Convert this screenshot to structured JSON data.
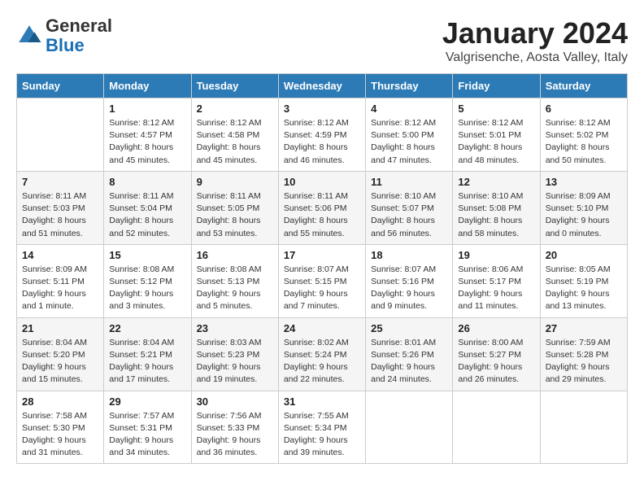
{
  "logo": {
    "general": "General",
    "blue": "Blue"
  },
  "title": "January 2024",
  "subtitle": "Valgrisenche, Aosta Valley, Italy",
  "days_of_week": [
    "Sunday",
    "Monday",
    "Tuesday",
    "Wednesday",
    "Thursday",
    "Friday",
    "Saturday"
  ],
  "weeks": [
    [
      {
        "day": "",
        "info": ""
      },
      {
        "day": "1",
        "info": "Sunrise: 8:12 AM\nSunset: 4:57 PM\nDaylight: 8 hours\nand 45 minutes."
      },
      {
        "day": "2",
        "info": "Sunrise: 8:12 AM\nSunset: 4:58 PM\nDaylight: 8 hours\nand 45 minutes."
      },
      {
        "day": "3",
        "info": "Sunrise: 8:12 AM\nSunset: 4:59 PM\nDaylight: 8 hours\nand 46 minutes."
      },
      {
        "day": "4",
        "info": "Sunrise: 8:12 AM\nSunset: 5:00 PM\nDaylight: 8 hours\nand 47 minutes."
      },
      {
        "day": "5",
        "info": "Sunrise: 8:12 AM\nSunset: 5:01 PM\nDaylight: 8 hours\nand 48 minutes."
      },
      {
        "day": "6",
        "info": "Sunrise: 8:12 AM\nSunset: 5:02 PM\nDaylight: 8 hours\nand 50 minutes."
      }
    ],
    [
      {
        "day": "7",
        "info": "Sunrise: 8:11 AM\nSunset: 5:03 PM\nDaylight: 8 hours\nand 51 minutes."
      },
      {
        "day": "8",
        "info": "Sunrise: 8:11 AM\nSunset: 5:04 PM\nDaylight: 8 hours\nand 52 minutes."
      },
      {
        "day": "9",
        "info": "Sunrise: 8:11 AM\nSunset: 5:05 PM\nDaylight: 8 hours\nand 53 minutes."
      },
      {
        "day": "10",
        "info": "Sunrise: 8:11 AM\nSunset: 5:06 PM\nDaylight: 8 hours\nand 55 minutes."
      },
      {
        "day": "11",
        "info": "Sunrise: 8:10 AM\nSunset: 5:07 PM\nDaylight: 8 hours\nand 56 minutes."
      },
      {
        "day": "12",
        "info": "Sunrise: 8:10 AM\nSunset: 5:08 PM\nDaylight: 8 hours\nand 58 minutes."
      },
      {
        "day": "13",
        "info": "Sunrise: 8:09 AM\nSunset: 5:10 PM\nDaylight: 9 hours\nand 0 minutes."
      }
    ],
    [
      {
        "day": "14",
        "info": "Sunrise: 8:09 AM\nSunset: 5:11 PM\nDaylight: 9 hours\nand 1 minute."
      },
      {
        "day": "15",
        "info": "Sunrise: 8:08 AM\nSunset: 5:12 PM\nDaylight: 9 hours\nand 3 minutes."
      },
      {
        "day": "16",
        "info": "Sunrise: 8:08 AM\nSunset: 5:13 PM\nDaylight: 9 hours\nand 5 minutes."
      },
      {
        "day": "17",
        "info": "Sunrise: 8:07 AM\nSunset: 5:15 PM\nDaylight: 9 hours\nand 7 minutes."
      },
      {
        "day": "18",
        "info": "Sunrise: 8:07 AM\nSunset: 5:16 PM\nDaylight: 9 hours\nand 9 minutes."
      },
      {
        "day": "19",
        "info": "Sunrise: 8:06 AM\nSunset: 5:17 PM\nDaylight: 9 hours\nand 11 minutes."
      },
      {
        "day": "20",
        "info": "Sunrise: 8:05 AM\nSunset: 5:19 PM\nDaylight: 9 hours\nand 13 minutes."
      }
    ],
    [
      {
        "day": "21",
        "info": "Sunrise: 8:04 AM\nSunset: 5:20 PM\nDaylight: 9 hours\nand 15 minutes."
      },
      {
        "day": "22",
        "info": "Sunrise: 8:04 AM\nSunset: 5:21 PM\nDaylight: 9 hours\nand 17 minutes."
      },
      {
        "day": "23",
        "info": "Sunrise: 8:03 AM\nSunset: 5:23 PM\nDaylight: 9 hours\nand 19 minutes."
      },
      {
        "day": "24",
        "info": "Sunrise: 8:02 AM\nSunset: 5:24 PM\nDaylight: 9 hours\nand 22 minutes."
      },
      {
        "day": "25",
        "info": "Sunrise: 8:01 AM\nSunset: 5:26 PM\nDaylight: 9 hours\nand 24 minutes."
      },
      {
        "day": "26",
        "info": "Sunrise: 8:00 AM\nSunset: 5:27 PM\nDaylight: 9 hours\nand 26 minutes."
      },
      {
        "day": "27",
        "info": "Sunrise: 7:59 AM\nSunset: 5:28 PM\nDaylight: 9 hours\nand 29 minutes."
      }
    ],
    [
      {
        "day": "28",
        "info": "Sunrise: 7:58 AM\nSunset: 5:30 PM\nDaylight: 9 hours\nand 31 minutes."
      },
      {
        "day": "29",
        "info": "Sunrise: 7:57 AM\nSunset: 5:31 PM\nDaylight: 9 hours\nand 34 minutes."
      },
      {
        "day": "30",
        "info": "Sunrise: 7:56 AM\nSunset: 5:33 PM\nDaylight: 9 hours\nand 36 minutes."
      },
      {
        "day": "31",
        "info": "Sunrise: 7:55 AM\nSunset: 5:34 PM\nDaylight: 9 hours\nand 39 minutes."
      },
      {
        "day": "",
        "info": ""
      },
      {
        "day": "",
        "info": ""
      },
      {
        "day": "",
        "info": ""
      }
    ]
  ]
}
